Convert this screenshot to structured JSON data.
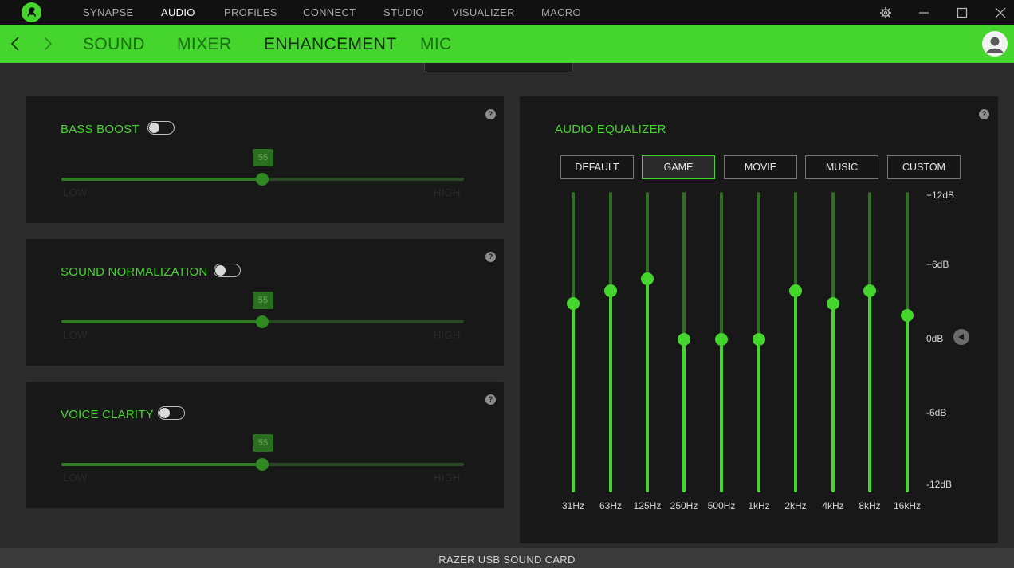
{
  "topnav": {
    "items": [
      {
        "label": "SYNAPSE",
        "active": false
      },
      {
        "label": "AUDIO",
        "active": true
      },
      {
        "label": "PROFILES",
        "active": false
      },
      {
        "label": "CONNECT",
        "active": false
      },
      {
        "label": "STUDIO",
        "active": false
      },
      {
        "label": "VISUALIZER",
        "active": false
      },
      {
        "label": "MACRO",
        "active": false
      }
    ]
  },
  "subnav": {
    "items": [
      {
        "label": "SOUND",
        "active": false
      },
      {
        "label": "MIXER",
        "active": false
      },
      {
        "label": "ENHANCEMENT",
        "active": true
      },
      {
        "label": "MIC",
        "active": false
      }
    ]
  },
  "enhancements": [
    {
      "title": "BASS BOOST",
      "enabled": false,
      "value": "55",
      "low": "LOW",
      "high": "HIGH"
    },
    {
      "title": "SOUND NORMALIZATION",
      "enabled": false,
      "value": "55",
      "low": "LOW",
      "high": "HIGH"
    },
    {
      "title": "VOICE CLARITY",
      "enabled": false,
      "value": "55",
      "low": "LOW",
      "high": "HIGH"
    }
  ],
  "help_glyph": "?",
  "equalizer": {
    "title": "AUDIO EQUALIZER",
    "presets": [
      {
        "label": "DEFAULT",
        "active": false
      },
      {
        "label": "GAME",
        "active": true
      },
      {
        "label": "MOVIE",
        "active": false
      },
      {
        "label": "MUSIC",
        "active": false
      },
      {
        "label": "CUSTOM",
        "active": false
      }
    ],
    "db_labels": [
      "+12dB",
      "+6dB",
      "0dB",
      "-6dB",
      "-12dB"
    ],
    "range_db": [
      -12,
      12
    ],
    "bands": [
      {
        "freq": "31Hz",
        "gain_db": 3
      },
      {
        "freq": "63Hz",
        "gain_db": 4
      },
      {
        "freq": "125Hz",
        "gain_db": 5
      },
      {
        "freq": "250Hz",
        "gain_db": 0
      },
      {
        "freq": "500Hz",
        "gain_db": 0
      },
      {
        "freq": "1kHz",
        "gain_db": 0
      },
      {
        "freq": "2kHz",
        "gain_db": 4
      },
      {
        "freq": "4kHz",
        "gain_db": 3
      },
      {
        "freq": "8kHz",
        "gain_db": 4
      },
      {
        "freq": "16kHz",
        "gain_db": 2
      }
    ]
  },
  "footer": {
    "device": "RAZER USB SOUND CARD"
  },
  "colors": {
    "accent": "#44d62c",
    "topbar": "#111111",
    "panel": "#181818",
    "background": "#2b2b2b"
  }
}
